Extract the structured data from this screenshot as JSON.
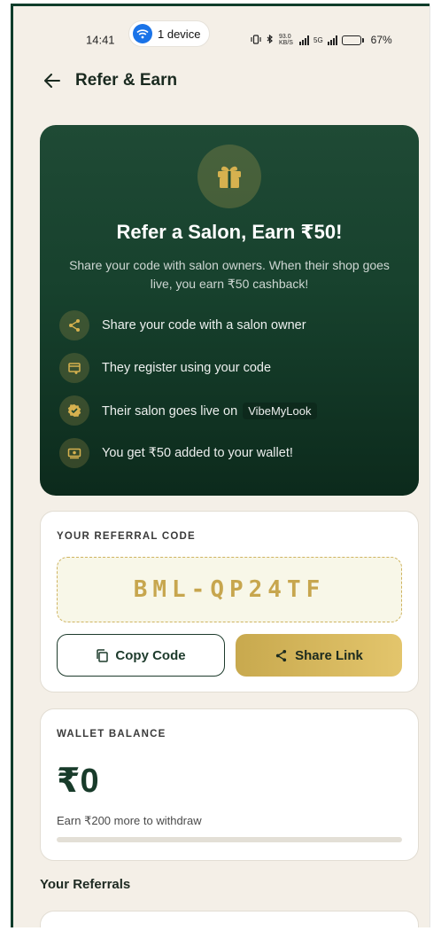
{
  "status_bar": {
    "time": "14:41",
    "device_label": "1 device",
    "net_speed": "93.0 KB/S",
    "network": "5G",
    "battery": "67%",
    "battery_level": 0.67
  },
  "header": {
    "title": "Refer & Earn"
  },
  "hero": {
    "title": "Refer a Salon, Earn ₹50!",
    "subtitle": "Share your code with salon owners. When their shop goes live, you earn ₹50 cashback!",
    "steps": [
      {
        "icon": "share-icon",
        "text": "Share your code with a salon owner"
      },
      {
        "icon": "register-icon",
        "text": "They register using your code"
      },
      {
        "icon": "verified-icon",
        "text": "Their salon goes live on",
        "brand": "VibeMyLook"
      },
      {
        "icon": "wallet-icon",
        "text": "You get ₹50 added to your wallet!"
      }
    ]
  },
  "referral": {
    "label": "YOUR REFERRAL CODE",
    "code": "BML-QP24TF",
    "copy_label": "Copy Code",
    "share_label": "Share Link"
  },
  "wallet": {
    "label": "WALLET BALANCE",
    "amount": "₹0",
    "note": "Earn ₹200 more to withdraw",
    "progress": 0
  },
  "referrals_section": {
    "title": "Your Referrals"
  },
  "colors": {
    "brand_green": "#17412d",
    "gold": "#c7a64e",
    "background": "#f4efe7"
  }
}
